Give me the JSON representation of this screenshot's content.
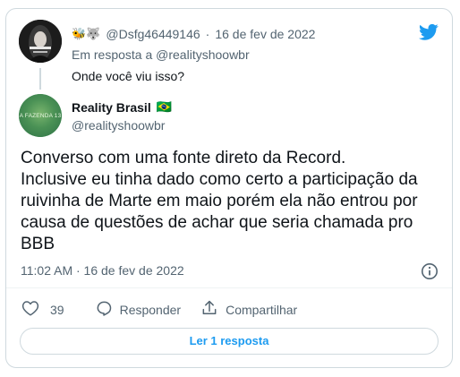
{
  "reply": {
    "handle": "@Dsfg46449146",
    "date": "16 de fev de 2022",
    "emojis": "🐝🐺",
    "reply_to": "Em resposta a @realityshoowbr",
    "text": "Onde você viu isso?"
  },
  "tweet": {
    "name": "Reality Brasil",
    "flag": "🇧🇷",
    "handle": "@realityshoowbr",
    "avatar_text": "A FAZENDA 13",
    "body": "Converso com uma fonte direto da Record.\nInclusive eu tinha dado como certo a participação da ruivinha de Marte em maio porém ela não entrou por causa de questões de achar que seria chamada pro BBB",
    "timestamp": "11:02 AM · 16 de fev de 2022"
  },
  "actions": {
    "likes": "39",
    "reply_label": "Responder",
    "share_label": "Compartilhar"
  },
  "read_replies": "Ler 1 resposta",
  "colors": {
    "accent": "#1d9bf0",
    "text": "#0f1419",
    "muted": "#536471",
    "border": "#cfd9de"
  }
}
